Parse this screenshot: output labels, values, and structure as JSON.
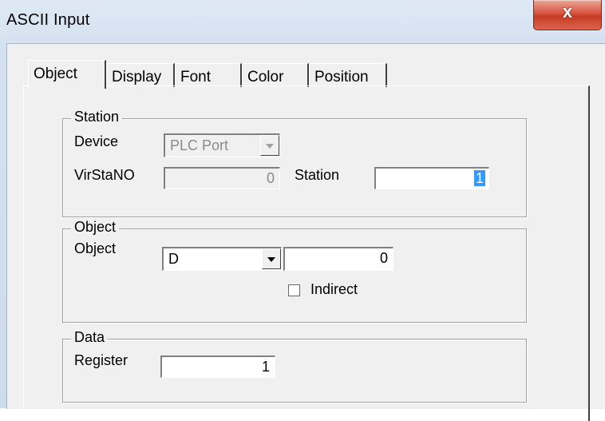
{
  "window": {
    "title": "ASCII Input",
    "close_glyph": "x"
  },
  "tabs": [
    "Object",
    "Display",
    "Font",
    "Color",
    "Position"
  ],
  "station_group": {
    "label": "Station",
    "device_label": "Device",
    "device_value": "PLC Port",
    "virstano_label": "VirStaNO",
    "virstano_value": "0",
    "station_label": "Station",
    "station_value": "1"
  },
  "object_group": {
    "label": "Object",
    "object_label": "Object",
    "object_type": "D",
    "object_address": "0",
    "indirect_label": "Indirect",
    "indirect_checked": false
  },
  "data_group": {
    "label": "Data",
    "register_label": "Register",
    "register_value": "1"
  },
  "colors": {
    "selection": "#3399ff",
    "close_button": "#c73a22"
  },
  "icons": {
    "close": "close-icon",
    "dropdown": "chevron-down-icon"
  }
}
